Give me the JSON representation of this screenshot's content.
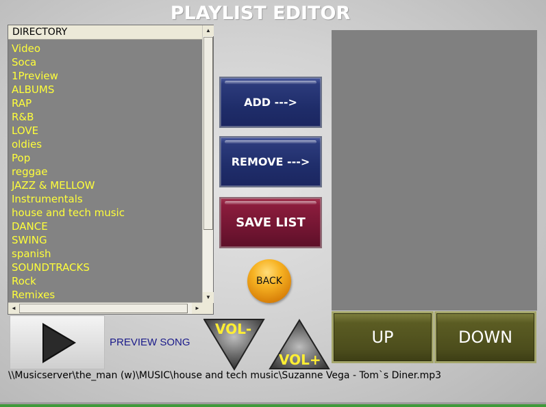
{
  "title": "PLAYLIST EDITOR",
  "directory": {
    "header": "DIRECTORY",
    "items": [
      "Video",
      "Soca",
      "1Preview",
      "ALBUMS",
      "RAP",
      "R&B",
      "LOVE",
      "oldies",
      "Pop",
      "reggae",
      "JAZZ & MELLOW",
      "Instrumentals",
      "house and tech music",
      "DANCE",
      "SWING",
      "spanish",
      "SOUNDTRACKS",
      "Rock",
      "Remixes"
    ],
    "scroll_up_icon": "▲",
    "scroll_down_icon": "▼",
    "scroll_left_icon": "◄",
    "scroll_right_icon": "►"
  },
  "buttons": {
    "add": "ADD --->",
    "remove": "REMOVE --->",
    "save": "SAVE LIST",
    "back": "BACK",
    "up": "UP",
    "down": "DOWN",
    "vol_minus": "VOL-",
    "vol_plus": "VOL+"
  },
  "preview_label": "PREVIEW SONG",
  "current_path": "\\\\Musicserver\\the_man (w)\\MUSIC\\house and tech music\\Suzanne Vega - Tom`s Diner.mp3",
  "colors": {
    "list_text": "#ffff3a",
    "list_bg": "#838383",
    "blue_button": "#1f2d6a",
    "red_button": "#6e1430",
    "olive_button": "#4c4d1c",
    "back_button": "#f7b323"
  }
}
